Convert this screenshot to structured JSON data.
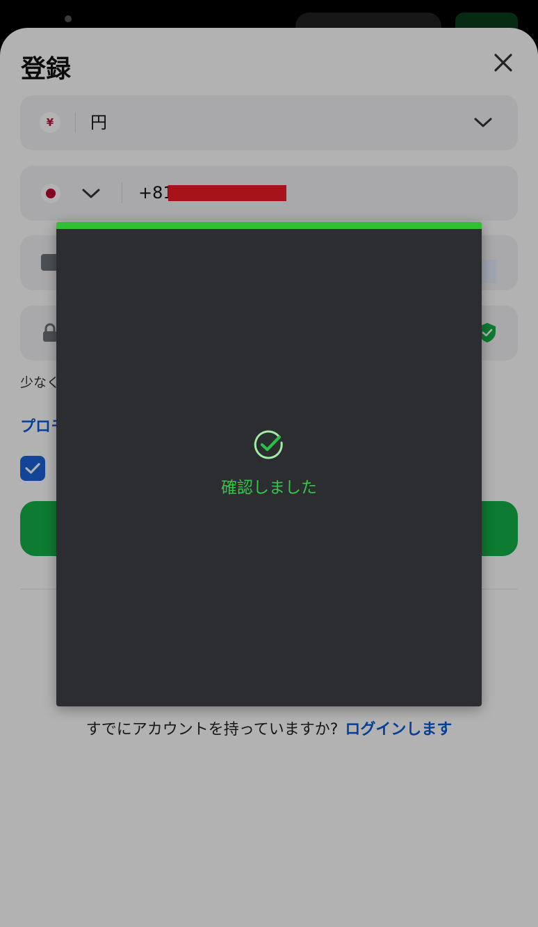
{
  "dialog": {
    "title": "登録",
    "close_icon": "close-icon"
  },
  "currency": {
    "symbol": "¥",
    "value": "円",
    "icon": "yen-icon"
  },
  "phone": {
    "country_flag": "japan-flag-icon",
    "prefix": "+81",
    "redacted": true
  },
  "email": {
    "icon": "email-icon"
  },
  "password": {
    "icon": "lock-icon",
    "strength_icon": "shield-check-icon"
  },
  "hint_text": "少なく",
  "promo_link": "プロモ",
  "agree_checkbox": {
    "checked": true
  },
  "submit": {
    "label": ""
  },
  "footer": {
    "question": "すでにアカウントを持っていますか?",
    "login_link": "ログインします"
  },
  "verification": {
    "message": "確認しました",
    "icon": "check-circle-icon"
  },
  "colors": {
    "accent_green": "#2fc133",
    "link_blue": "#0a5bd6",
    "modal_bg": "#2c2d31",
    "redaction_red": "#ee1c25"
  }
}
